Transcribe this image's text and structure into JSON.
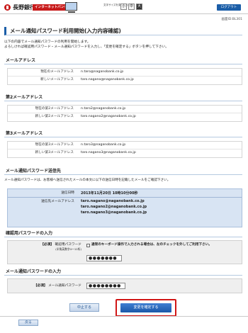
{
  "header": {
    "bank_name": "長野銀行",
    "ib_badge": "インターネットバンキング",
    "font_size_label": "文字サイズを変更する",
    "font_sizes": [
      "小",
      "中",
      "大"
    ],
    "logout_label": "ログアウト"
  },
  "screen_id": "画面ID:BL301",
  "page_title": "メール通知パスワード利用開始(入力内容確認)",
  "intro": [
    "以下の内容でメール通知パスワードの利用を開始します。",
    "よろしければ確認用パスワード・メール通知パスワードを入力し、「変更を確定する」ボタンを押して下さい。"
  ],
  "email1": {
    "title": "メールアドレス",
    "rows": [
      {
        "label": "現在のメールアドレス",
        "value": "n.taro@naganobank.co.jp"
      },
      {
        "label": "新しいメールアドレス",
        "value": "taro.nagano@naganobank.co.jp"
      }
    ]
  },
  "email2": {
    "title": "第2メールアドレス",
    "rows": [
      {
        "label": "現在の第2メールアドレス",
        "value": "n.taro2@naganobank.co.jp"
      },
      {
        "label": "新しい第2メールアドレス",
        "value": "taro.nagano2@naganobank.co.jp"
      }
    ]
  },
  "email3": {
    "title": "第3メールアドレス",
    "rows": [
      {
        "label": "現在の第3メールアドレス",
        "value": "n.taro3@naganobank.co.jp"
      },
      {
        "label": "新しい第3メールアドレス",
        "value": "taro.nagano3@naganobank.co.jp"
      }
    ]
  },
  "notify": {
    "title": "メール通知パスワード送信先",
    "note": "メール通知パスワードは、お客様へ送信されたメールの本文に以下の送信日時を記載したメールをご確認下さい。",
    "sent_label": "送信日時",
    "sent_value": "2013年11月20日 10時10分00秒",
    "dest_label": "送信先メールアドレス",
    "dest_values": [
      "taro.nagano@naganobank.co.jp",
      "taro.nagano2@naganobank.co.jp",
      "taro.nagano3@naganobank.co.jp"
    ]
  },
  "confirm_pw": {
    "title": "確認用パスワードの入力",
    "required": "【必須】",
    "label": "確認用パスワード",
    "sub_label": "(半角英数字4～12桁)",
    "checkbox_text": "通常のキーボード操作で入力される場合は、左のチェックを外してご利用下さい。",
    "value": "●●●●●●●"
  },
  "mail_pw": {
    "title": "メール通知パスワードの入力",
    "required": "【必須】",
    "label": "メール通知パスワード",
    "value": "●●●●●●●●"
  },
  "buttons": {
    "stop": "中止する",
    "confirm": "変更を確定する",
    "back": "戻る"
  },
  "colors": {
    "brand_red": "#c81a1a",
    "primary_blue": "#1b5ea8",
    "highlight_red": "#d11616",
    "info_blue_bg": "#d8e4f3"
  }
}
